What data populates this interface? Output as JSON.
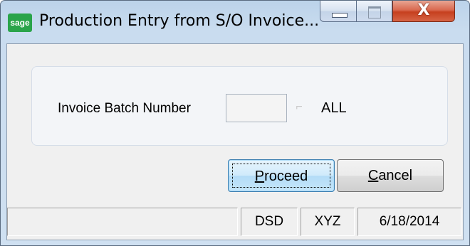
{
  "window": {
    "app_icon_label": "sage",
    "title": "Production Entry from S/O Invoice...",
    "close_glyph": "X"
  },
  "form": {
    "batch_label": "Invoice Batch Number",
    "batch_value": "",
    "all_label": "ALL",
    "lookup_glyph": "⌐"
  },
  "buttons": {
    "proceed_hotkey": "P",
    "proceed_rest": "roceed",
    "cancel_hotkey": "C",
    "cancel_rest": "ancel"
  },
  "status_bar": {
    "left": "",
    "company": "DSD",
    "user": "XYZ",
    "date": "6/18/2014"
  },
  "colors": {
    "sage_green": "#2aa44a",
    "close_red": "#c6401f",
    "default_button_blue": "#3c7fb1"
  }
}
